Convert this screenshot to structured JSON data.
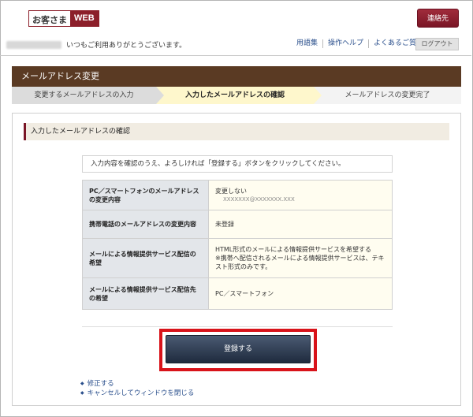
{
  "header": {
    "logo_text": "お客さま",
    "logo_web": "WEB",
    "contact_label": "連絡先",
    "greeting": "いつもご利用ありがとうございます。",
    "links": [
      "用語集",
      "操作ヘルプ",
      "よくあるご質問"
    ],
    "logout_label": "ログアウト"
  },
  "page": {
    "title": "メールアドレス変更",
    "steps": [
      "変更するメールアドレスの入力",
      "入力したメールアドレスの確認",
      "メールアドレスの変更完了"
    ],
    "current_step": 2
  },
  "section": {
    "heading": "入力したメールアドレスの確認",
    "notice": "入力内容を確認のうえ、よろしければ「登録する」ボタンをクリックしてください。"
  },
  "table": {
    "rows": [
      {
        "label": "PC／スマートフォンのメールアドレスの変更内容",
        "value": "変更しない",
        "sub": "XXXXXXX@XXXXXXX.XXX"
      },
      {
        "label": "携帯電話のメールアドレスの変更内容",
        "value": "未登録"
      },
      {
        "label": "メールによる情報提供サービス配信の希望",
        "value": "HTML形式のメールによる情報提供サービスを希望する\n※携帯へ配信されるメールによる情報提供サービスは、テキスト形式のみです。"
      },
      {
        "label": "メールによる情報提供サービス配信先の希望",
        "value": "PC／スマートフォン"
      }
    ]
  },
  "actions": {
    "submit_label": "登録する",
    "edit_label": "修正する",
    "cancel_label": "キャンセルしてウィンドウを閉じる"
  },
  "colors": {
    "brand": "#8c1f2a",
    "title_bar": "#5a3a23",
    "highlight": "#d8131a"
  }
}
